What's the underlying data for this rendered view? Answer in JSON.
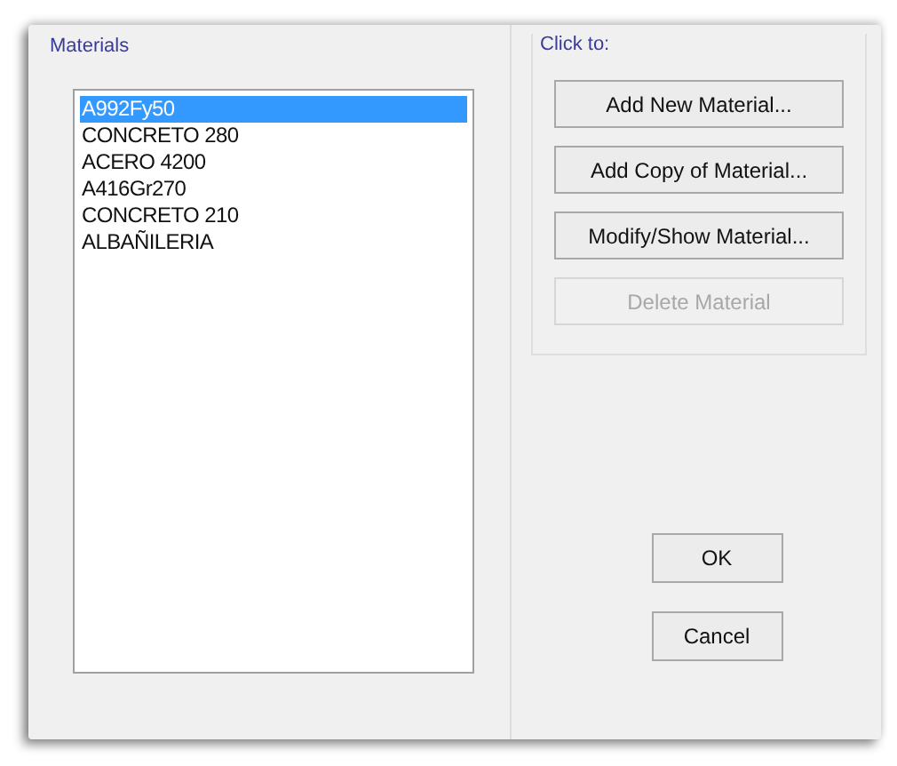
{
  "materials": {
    "label": "Materials",
    "items": [
      {
        "name": "A992Fy50",
        "selected": true
      },
      {
        "name": "CONCRETO 280",
        "selected": false
      },
      {
        "name": "ACERO 4200",
        "selected": false
      },
      {
        "name": "A416Gr270",
        "selected": false
      },
      {
        "name": "CONCRETO 210",
        "selected": false
      },
      {
        "name": "ALBAÑILERIA",
        "selected": false
      }
    ]
  },
  "actions": {
    "label": "Click to:",
    "buttons": [
      {
        "label": "Add New Material...",
        "disabled": false
      },
      {
        "label": "Add Copy of Material...",
        "disabled": false
      },
      {
        "label": "Modify/Show Material...",
        "disabled": false
      },
      {
        "label": "Delete Material",
        "disabled": true
      }
    ]
  },
  "buttons": [
    "OK",
    "Cancel"
  ]
}
